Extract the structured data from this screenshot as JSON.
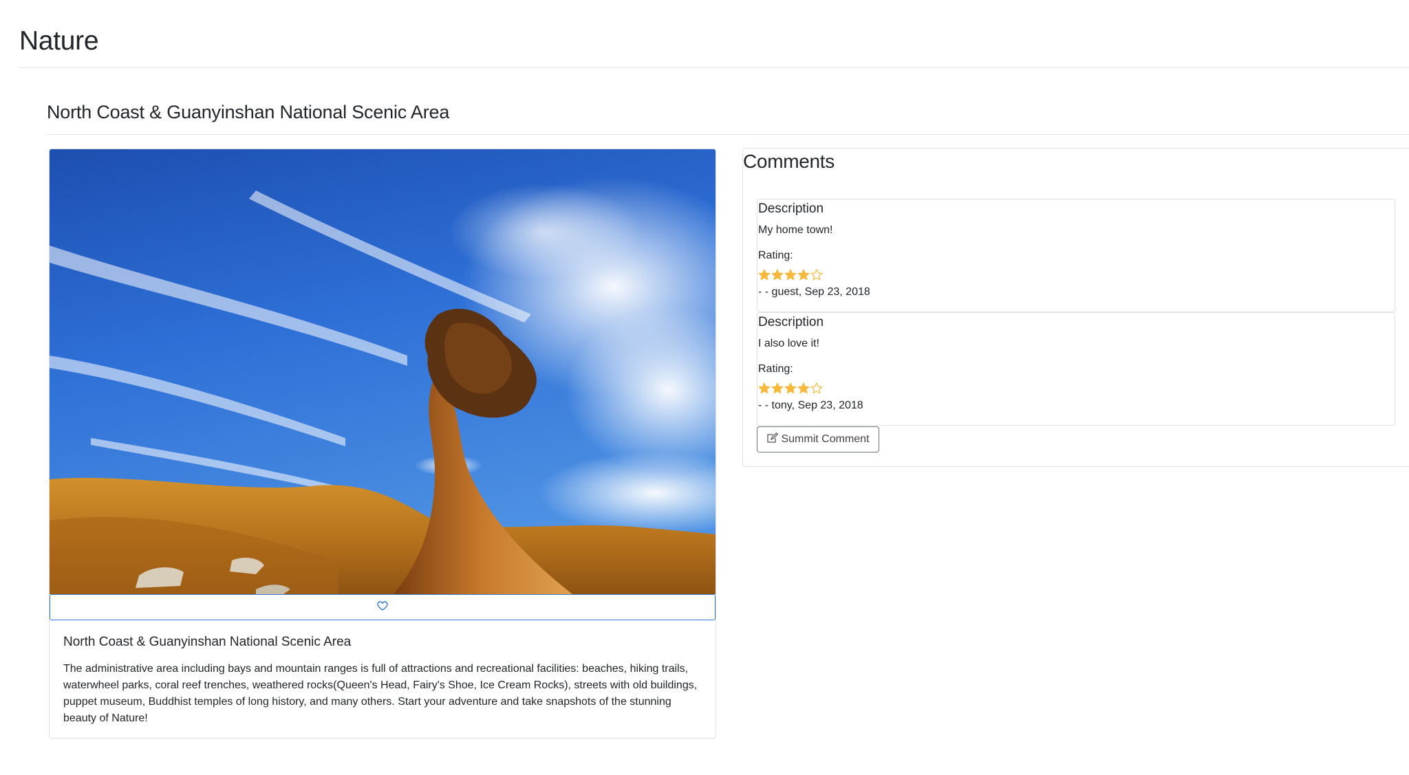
{
  "page": {
    "title": "Nature"
  },
  "section": {
    "title": "North Coast & Guanyinshan National Scenic Area"
  },
  "card": {
    "image_icon": "queens-head-rock-photo",
    "like_icon": "heart-outline-icon",
    "title": "North Coast & Guanyinshan National Scenic Area",
    "description": "The administrative area including bays and mountain ranges is full of attractions and recreational facilities: beaches, hiking trails, waterwheel parks, coral reef trenches, weathered rocks(Queen's Head, Fairy's Shoe, Ice Cream Rocks), streets with old buildings, puppet museum, Buddhist temples of long history, and many others. Start your adventure and take snapshots of the stunning beauty of Nature!"
  },
  "comments": {
    "heading": "Comments",
    "items": [
      {
        "title": "Description",
        "text": "My home town!",
        "rating_label": "Rating:",
        "rating": 4,
        "max_rating": 5,
        "byline": "- - guest, Sep 23, 2018"
      },
      {
        "title": "Description",
        "text": "I also love it!",
        "rating_label": "Rating:",
        "rating": 4,
        "max_rating": 5,
        "byline": "- - tony, Sep 23, 2018"
      }
    ],
    "submit_label": "Summit Comment",
    "submit_icon": "edit-icon"
  },
  "colors": {
    "star": "#f6b93b",
    "like_border": "#2f7ad8",
    "text": "#212529"
  }
}
